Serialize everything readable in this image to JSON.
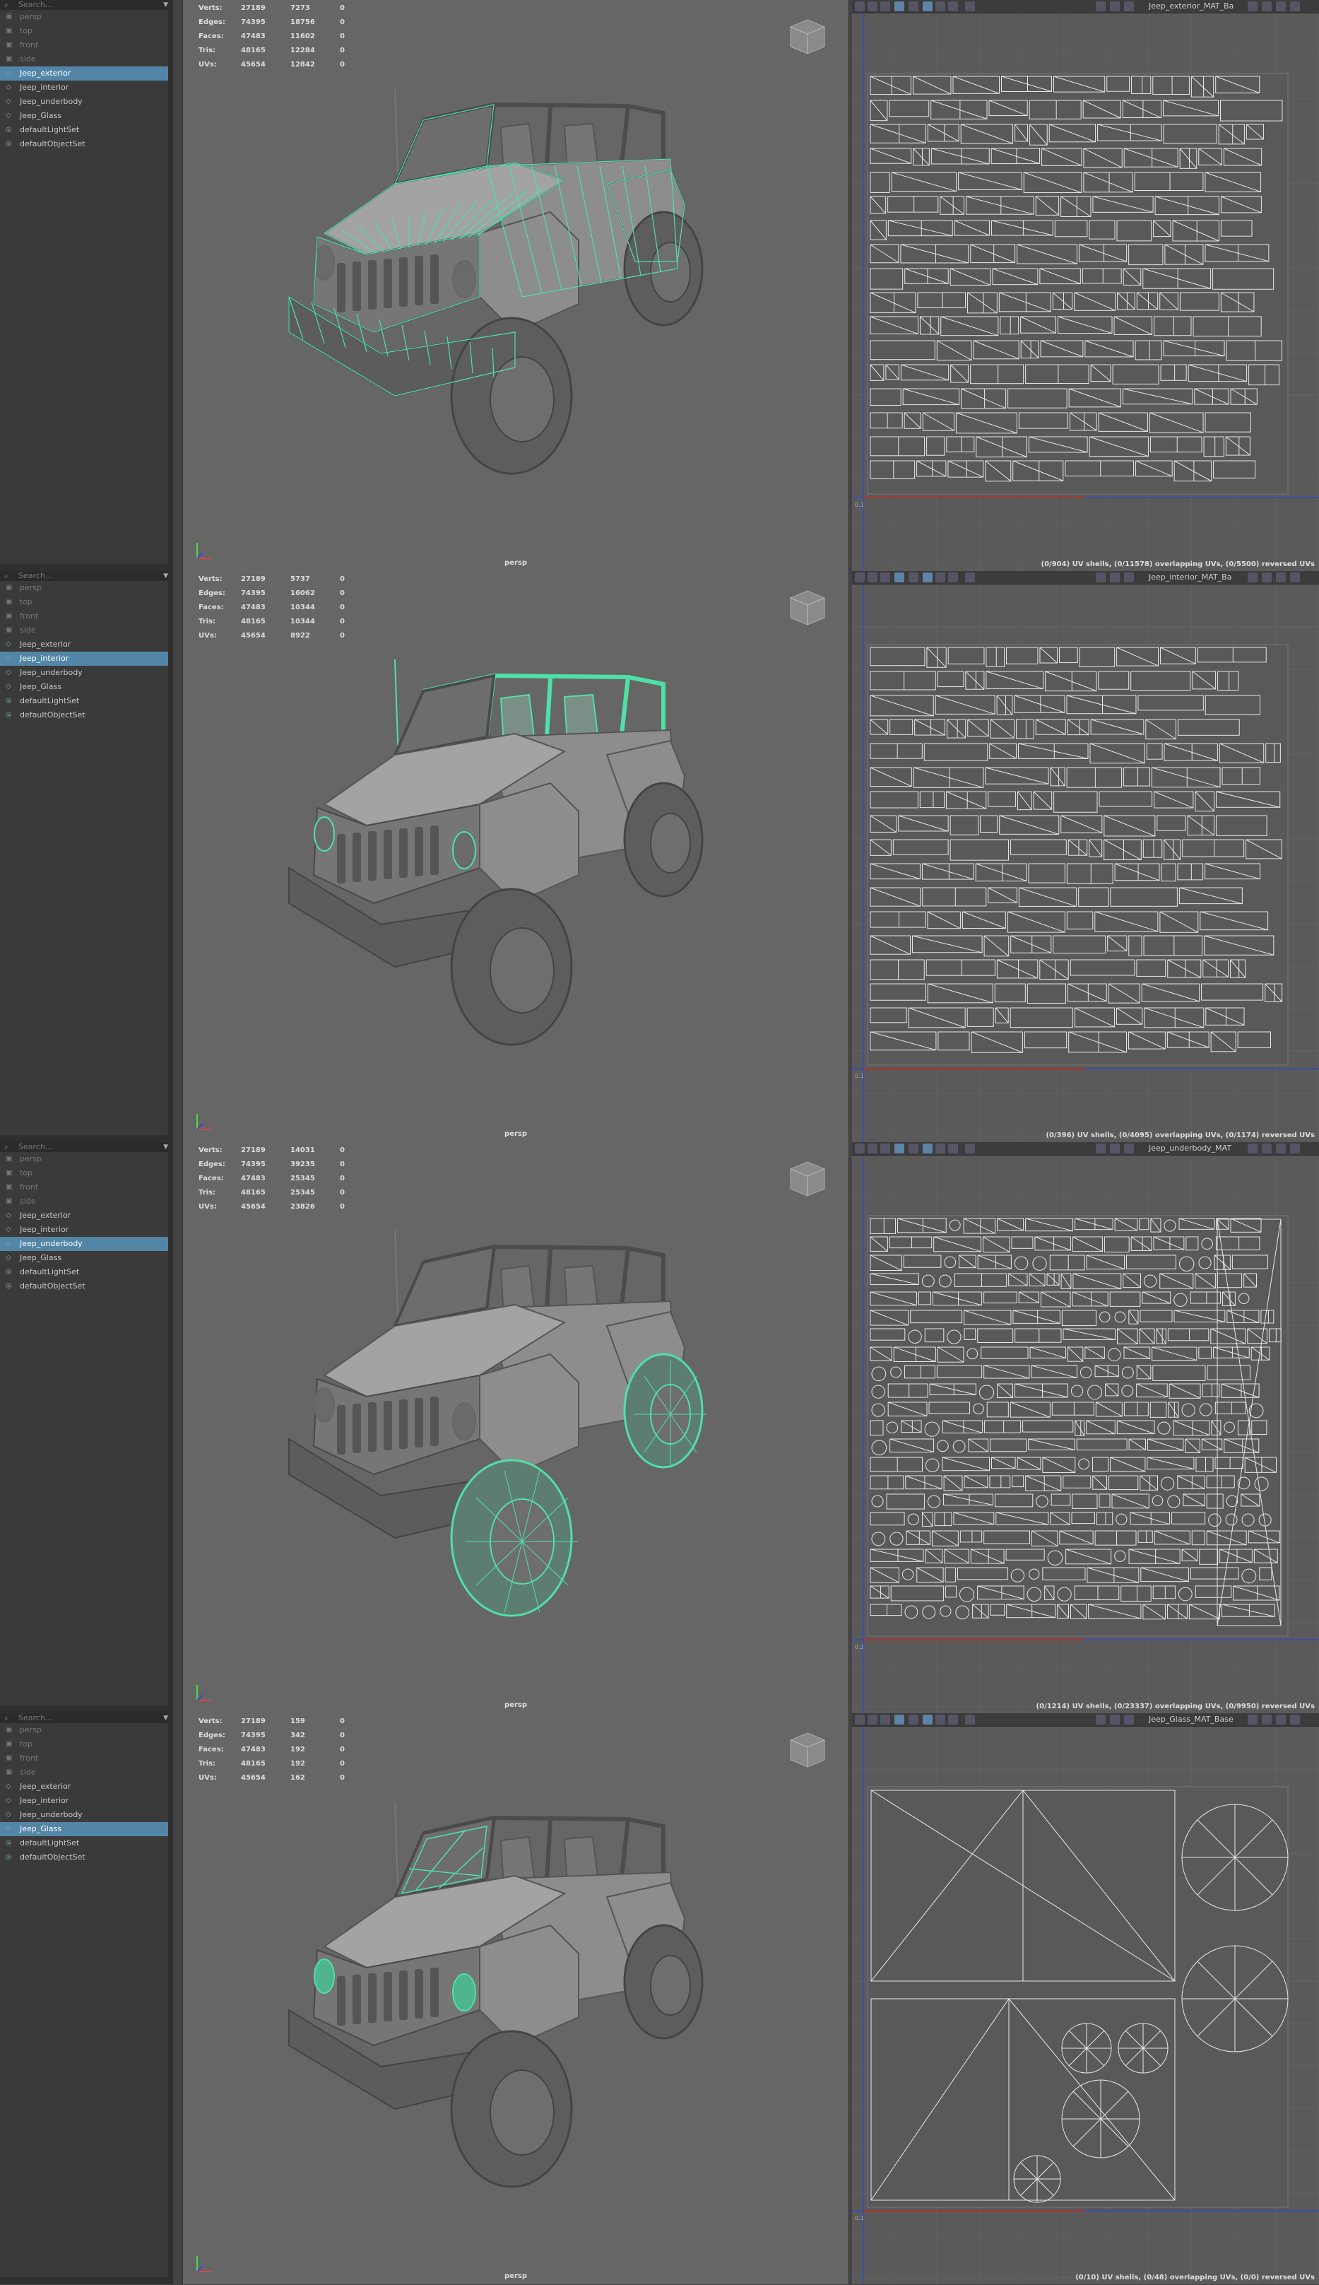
{
  "search": {
    "placeholder": "Search..."
  },
  "panels": [
    {
      "outliner": {
        "items": [
          {
            "label": "persp",
            "kind": "camera"
          },
          {
            "label": "top",
            "kind": "camera"
          },
          {
            "label": "front",
            "kind": "camera"
          },
          {
            "label": "side",
            "kind": "camera"
          },
          {
            "label": "Jeep_exterior",
            "kind": "mesh",
            "selected": true
          },
          {
            "label": "Jeep_interior",
            "kind": "mesh"
          },
          {
            "label": "Jeep_underbody",
            "kind": "mesh"
          },
          {
            "label": "Jeep_Glass",
            "kind": "mesh"
          },
          {
            "label": "defaultLightSet",
            "kind": "set"
          },
          {
            "label": "defaultObjectSet",
            "kind": "set"
          }
        ]
      },
      "hud": [
        {
          "label": "Verts:",
          "a": "27189",
          "b": "7273",
          "c": "0"
        },
        {
          "label": "Edges:",
          "a": "74395",
          "b": "18756",
          "c": "0"
        },
        {
          "label": "Faces:",
          "a": "47483",
          "b": "11602",
          "c": "0"
        },
        {
          "label": "Tris:",
          "a": "48165",
          "b": "12284",
          "c": "0"
        },
        {
          "label": "UVs:",
          "a": "45654",
          "b": "12842",
          "c": "0"
        }
      ],
      "camera": "persp",
      "uv_title": "Jeep_exterior_MAT_Ba",
      "uv_status": "(0/904) UV shells, (0/11578) overlapping UVs, (0/5500) reversed UVs",
      "highlight": "exterior"
    },
    {
      "outliner": {
        "items": [
          {
            "label": "persp",
            "kind": "camera"
          },
          {
            "label": "top",
            "kind": "camera"
          },
          {
            "label": "front",
            "kind": "camera"
          },
          {
            "label": "side",
            "kind": "camera"
          },
          {
            "label": "Jeep_exterior",
            "kind": "mesh"
          },
          {
            "label": "Jeep_interior",
            "kind": "mesh",
            "selected": true
          },
          {
            "label": "Jeep_underbody",
            "kind": "mesh"
          },
          {
            "label": "Jeep_Glass",
            "kind": "mesh"
          },
          {
            "label": "defaultLightSet",
            "kind": "set"
          },
          {
            "label": "defaultObjectSet",
            "kind": "set"
          }
        ]
      },
      "hud": [
        {
          "label": "Verts:",
          "a": "27189",
          "b": "5737",
          "c": "0"
        },
        {
          "label": "Edges:",
          "a": "74395",
          "b": "16062",
          "c": "0"
        },
        {
          "label": "Faces:",
          "a": "47483",
          "b": "10344",
          "c": "0"
        },
        {
          "label": "Tris:",
          "a": "48165",
          "b": "10344",
          "c": "0"
        },
        {
          "label": "UVs:",
          "a": "45654",
          "b": "8922",
          "c": "0"
        }
      ],
      "camera": "persp",
      "uv_title": "Jeep_interior_MAT_Ba",
      "uv_status": "(0/396) UV shells, (0/4095) overlapping UVs, (0/1174) reversed UVs",
      "highlight": "interior"
    },
    {
      "outliner": {
        "items": [
          {
            "label": "persp",
            "kind": "camera"
          },
          {
            "label": "top",
            "kind": "camera"
          },
          {
            "label": "front",
            "kind": "camera"
          },
          {
            "label": "side",
            "kind": "camera"
          },
          {
            "label": "Jeep_exterior",
            "kind": "mesh"
          },
          {
            "label": "Jeep_interior",
            "kind": "mesh"
          },
          {
            "label": "Jeep_underbody",
            "kind": "mesh",
            "selected": true
          },
          {
            "label": "Jeep_Glass",
            "kind": "mesh"
          },
          {
            "label": "defaultLightSet",
            "kind": "set"
          },
          {
            "label": "defaultObjectSet",
            "kind": "set"
          }
        ]
      },
      "hud": [
        {
          "label": "Verts:",
          "a": "27189",
          "b": "14031",
          "c": "0"
        },
        {
          "label": "Edges:",
          "a": "74395",
          "b": "39235",
          "c": "0"
        },
        {
          "label": "Faces:",
          "a": "47483",
          "b": "25345",
          "c": "0"
        },
        {
          "label": "Tris:",
          "a": "48165",
          "b": "25345",
          "c": "0"
        },
        {
          "label": "UVs:",
          "a": "45654",
          "b": "23826",
          "c": "0"
        }
      ],
      "camera": "persp",
      "uv_title": "Jeep_underbody_MAT",
      "uv_status": "(0/1214) UV shells, (0/23337) overlapping UVs, (0/9950) reversed UVs",
      "highlight": "underbody"
    },
    {
      "outliner": {
        "items": [
          {
            "label": "persp",
            "kind": "camera"
          },
          {
            "label": "top",
            "kind": "camera"
          },
          {
            "label": "front",
            "kind": "camera"
          },
          {
            "label": "side",
            "kind": "camera"
          },
          {
            "label": "Jeep_exterior",
            "kind": "mesh"
          },
          {
            "label": "Jeep_interior",
            "kind": "mesh"
          },
          {
            "label": "Jeep_underbody",
            "kind": "mesh"
          },
          {
            "label": "Jeep_Glass",
            "kind": "mesh",
            "selected": true
          },
          {
            "label": "defaultLightSet",
            "kind": "set"
          },
          {
            "label": "defaultObjectSet",
            "kind": "set"
          }
        ]
      },
      "hud": [
        {
          "label": "Verts:",
          "a": "27189",
          "b": "159",
          "c": "0"
        },
        {
          "label": "Edges:",
          "a": "74395",
          "b": "342",
          "c": "0"
        },
        {
          "label": "Faces:",
          "a": "47483",
          "b": "192",
          "c": "0"
        },
        {
          "label": "Tris:",
          "a": "48165",
          "b": "192",
          "c": "0"
        },
        {
          "label": "UVs:",
          "a": "45654",
          "b": "162",
          "c": "0"
        }
      ],
      "camera": "persp",
      "uv_title": "Jeep_Glass_MAT_Base",
      "uv_status": "(0/10) UV shells, (0/48) overlapping UVs, (0/0) reversed UVs",
      "highlight": "glass"
    }
  ],
  "colors": {
    "accent": "#5285a6",
    "wire": "#4fe0a8",
    "viewport": "#666666"
  }
}
